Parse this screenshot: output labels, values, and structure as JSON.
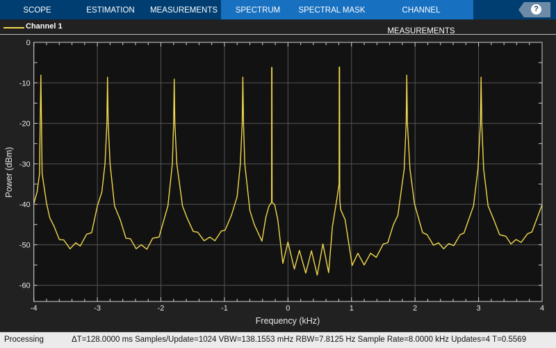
{
  "tabs": [
    {
      "label": "SCOPE",
      "active": false
    },
    {
      "label": "ESTIMATION",
      "active": false
    },
    {
      "label": "MEASUREMENTS",
      "active": false
    },
    {
      "label": "SPECTRUM",
      "active": true
    },
    {
      "label": "SPECTRAL MASK",
      "active": true
    },
    {
      "label": "CHANNEL MEASUREMENTS",
      "active": true
    }
  ],
  "help_label": "?",
  "legend": {
    "label": "Channel 1",
    "color": "#f2d94e"
  },
  "status": {
    "state": "Processing",
    "info": "ΔT=128.0000 ms  Samples/Update=1024  VBW=138.1553 mHz  RBW=7.8125 Hz  Sample Rate=8.0000 kHz  Updates=4  T=0.5569"
  },
  "chart_data": {
    "type": "line",
    "xlabel": "Frequency (kHz)",
    "ylabel": "Power (dBm)",
    "xlim": [
      -4,
      4
    ],
    "ylim": [
      -64,
      0
    ],
    "xticks": [
      -4,
      -3,
      -2,
      -1,
      0,
      1,
      2,
      3,
      4
    ],
    "yticks": [
      0,
      -10,
      -20,
      -30,
      -40,
      -50,
      -60
    ],
    "grid": true,
    "background": "#121212",
    "series": [
      {
        "name": "Channel 1",
        "color": "#f2d94e",
        "points": [
          [
            -4.0,
            -39.8
          ],
          [
            -3.95,
            -37
          ],
          [
            -3.91,
            -32.4
          ],
          [
            -3.9,
            -20
          ],
          [
            -3.89,
            -8.1
          ],
          [
            -3.88,
            -20
          ],
          [
            -3.87,
            -32.4
          ],
          [
            -3.8,
            -39.8
          ],
          [
            -3.75,
            -43.3
          ],
          [
            -3.68,
            -45.5
          ],
          [
            -3.6,
            -48.7
          ],
          [
            -3.53,
            -48.8
          ],
          [
            -3.43,
            -51
          ],
          [
            -3.34,
            -49.5
          ],
          [
            -3.27,
            -50.3
          ],
          [
            -3.17,
            -47.4
          ],
          [
            -3.09,
            -47
          ],
          [
            -3.0,
            -40.4
          ],
          [
            -2.93,
            -37
          ],
          [
            -2.88,
            -30
          ],
          [
            -2.85,
            -20
          ],
          [
            -2.84,
            -8.6
          ],
          [
            -2.83,
            -20
          ],
          [
            -2.8,
            -30
          ],
          [
            -2.73,
            -40.4
          ],
          [
            -2.64,
            -43.8
          ],
          [
            -2.55,
            -48.4
          ],
          [
            -2.48,
            -48.5
          ],
          [
            -2.39,
            -51
          ],
          [
            -2.31,
            -50
          ],
          [
            -2.22,
            -51.1
          ],
          [
            -2.13,
            -48.4
          ],
          [
            -2.03,
            -48.1
          ],
          [
            -1.89,
            -40.4
          ],
          [
            -1.82,
            -30
          ],
          [
            -1.8,
            -20
          ],
          [
            -1.79,
            -9.1
          ],
          [
            -1.78,
            -20
          ],
          [
            -1.75,
            -30
          ],
          [
            -1.66,
            -40.4
          ],
          [
            -1.59,
            -43.3
          ],
          [
            -1.49,
            -46.7
          ],
          [
            -1.42,
            -46.9
          ],
          [
            -1.32,
            -49
          ],
          [
            -1.23,
            -48.1
          ],
          [
            -1.15,
            -49
          ],
          [
            -1.05,
            -46.6
          ],
          [
            -0.99,
            -46.4
          ],
          [
            -0.89,
            -42.7
          ],
          [
            -0.8,
            -38.1
          ],
          [
            -0.75,
            -30
          ],
          [
            -0.72,
            -20
          ],
          [
            -0.71,
            -8.6
          ],
          [
            -0.7,
            -20
          ],
          [
            -0.68,
            -30
          ],
          [
            -0.6,
            -41.5
          ],
          [
            -0.53,
            -45
          ],
          [
            -0.41,
            -49.1
          ],
          [
            -0.35,
            -43.3
          ],
          [
            -0.3,
            -40.5
          ],
          [
            -0.258,
            -39.5
          ],
          [
            -0.256,
            -6.2
          ],
          [
            -0.252,
            -6.2
          ],
          [
            -0.25,
            -39.5
          ],
          [
            -0.21,
            -40.1
          ],
          [
            -0.16,
            -43.8
          ],
          [
            -0.08,
            -54.6
          ],
          [
            0.0,
            -49.3
          ],
          [
            0.1,
            -56
          ],
          [
            0.18,
            -51.4
          ],
          [
            0.28,
            -57
          ],
          [
            0.37,
            -51.5
          ],
          [
            0.46,
            -57.5
          ],
          [
            0.55,
            -49.8
          ],
          [
            0.64,
            -56.9
          ],
          [
            0.7,
            -45.5
          ],
          [
            0.77,
            -38.7
          ],
          [
            0.805,
            -35
          ],
          [
            0.807,
            -6.1
          ],
          [
            0.812,
            -6.1
          ],
          [
            0.815,
            -39
          ],
          [
            0.83,
            -41.3
          ],
          [
            0.9,
            -43.8
          ],
          [
            1.01,
            -55.1
          ],
          [
            1.1,
            -52.1
          ],
          [
            1.2,
            -55
          ],
          [
            1.3,
            -52.1
          ],
          [
            1.39,
            -53.1
          ],
          [
            1.5,
            -49.8
          ],
          [
            1.57,
            -49.5
          ],
          [
            1.66,
            -45
          ],
          [
            1.73,
            -42.7
          ],
          [
            1.83,
            -31.3
          ],
          [
            1.86,
            -20
          ],
          [
            1.87,
            -8.1
          ],
          [
            1.88,
            -20
          ],
          [
            1.92,
            -31.3
          ],
          [
            1.99,
            -39.8
          ],
          [
            2.12,
            -47
          ],
          [
            2.19,
            -47.5
          ],
          [
            2.29,
            -50.1
          ],
          [
            2.37,
            -49.5
          ],
          [
            2.45,
            -51
          ],
          [
            2.53,
            -49.7
          ],
          [
            2.61,
            -50.2
          ],
          [
            2.71,
            -47.5
          ],
          [
            2.77,
            -47.1
          ],
          [
            2.92,
            -40.4
          ],
          [
            2.99,
            -31.3
          ],
          [
            3.03,
            -20
          ],
          [
            3.04,
            -8.6
          ],
          [
            3.05,
            -20
          ],
          [
            3.08,
            -31.3
          ],
          [
            3.15,
            -40.4
          ],
          [
            3.24,
            -43.8
          ],
          [
            3.33,
            -47.5
          ],
          [
            3.43,
            -47.9
          ],
          [
            3.51,
            -49.8
          ],
          [
            3.59,
            -48.7
          ],
          [
            3.67,
            -49.4
          ],
          [
            3.77,
            -47.3
          ],
          [
            3.84,
            -46.8
          ],
          [
            4.0,
            -40.1
          ]
        ]
      }
    ]
  }
}
